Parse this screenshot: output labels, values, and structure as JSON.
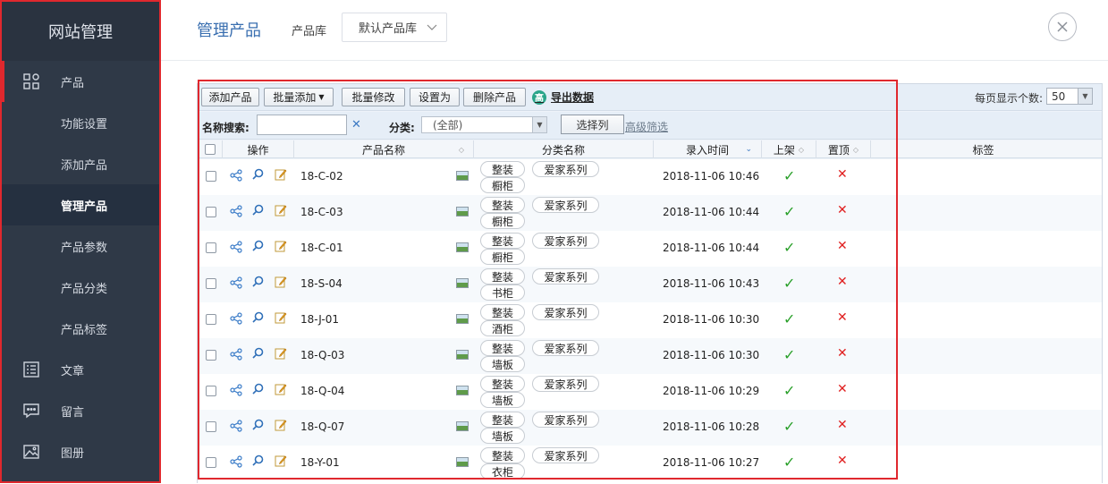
{
  "sidebar": {
    "brand": "网站管理",
    "top_items": [
      {
        "label": "产品",
        "icon": "grid-icon"
      },
      {
        "label": "文章",
        "icon": "list-icon"
      },
      {
        "label": "留言",
        "icon": "message-icon"
      },
      {
        "label": "图册",
        "icon": "image-icon"
      }
    ],
    "sub_items": [
      "功能设置",
      "添加产品",
      "管理产品",
      "产品参数",
      "产品分类",
      "产品标签"
    ],
    "active_sub": "管理产品"
  },
  "header": {
    "title": "管理产品",
    "lib_label": "产品库",
    "lib_value": "默认产品库"
  },
  "toolbar": {
    "add": "添加产品",
    "batch_add": "批量添加",
    "batch_edit": "批量修改",
    "set_as": "设置为",
    "delete": "删除产品",
    "export_icon_text": "高",
    "export": "导出数据",
    "per_page_label": "每页显示个数:",
    "per_page_value": "50"
  },
  "filter": {
    "name_label": "名称搜索:",
    "name_value": "",
    "category_label": "分类:",
    "category_value": "(全部)",
    "choose_columns": "选择列",
    "advanced": "高级筛选"
  },
  "columns": {
    "ops": "操作",
    "name": "产品名称",
    "category": "分类名称",
    "time": "录入时间",
    "on_shelf": "上架",
    "top": "置顶",
    "tags": "标签"
  },
  "rows": [
    {
      "name": "18-C-02",
      "cat1": "整装",
      "cat2": "爱家系列",
      "cat3": "橱柜",
      "time": "2018-11-06 10:46",
      "on_shelf": "✓",
      "top": "✕"
    },
    {
      "name": "18-C-03",
      "cat1": "整装",
      "cat2": "爱家系列",
      "cat3": "橱柜",
      "time": "2018-11-06 10:44",
      "on_shelf": "✓",
      "top": "✕"
    },
    {
      "name": "18-C-01",
      "cat1": "整装",
      "cat2": "爱家系列",
      "cat3": "橱柜",
      "time": "2018-11-06 10:44",
      "on_shelf": "✓",
      "top": "✕"
    },
    {
      "name": "18-S-04",
      "cat1": "整装",
      "cat2": "爱家系列",
      "cat3": "书柜",
      "time": "2018-11-06 10:43",
      "on_shelf": "✓",
      "top": "✕"
    },
    {
      "name": "18-J-01",
      "cat1": "整装",
      "cat2": "爱家系列",
      "cat3": "酒柜",
      "time": "2018-11-06 10:30",
      "on_shelf": "✓",
      "top": "✕"
    },
    {
      "name": "18-Q-03",
      "cat1": "整装",
      "cat2": "爱家系列",
      "cat3": "墙板",
      "time": "2018-11-06 10:30",
      "on_shelf": "✓",
      "top": "✕"
    },
    {
      "name": "18-Q-04",
      "cat1": "整装",
      "cat2": "爱家系列",
      "cat3": "墙板",
      "time": "2018-11-06 10:29",
      "on_shelf": "✓",
      "top": "✕"
    },
    {
      "name": "18-Q-07",
      "cat1": "整装",
      "cat2": "爱家系列",
      "cat3": "墙板",
      "time": "2018-11-06 10:28",
      "on_shelf": "✓",
      "top": "✕"
    },
    {
      "name": "18-Y-01",
      "cat1": "整装",
      "cat2": "爱家系列",
      "cat3": "衣柜",
      "time": "2018-11-06 10:27",
      "on_shelf": "✓",
      "top": "✕"
    }
  ]
}
